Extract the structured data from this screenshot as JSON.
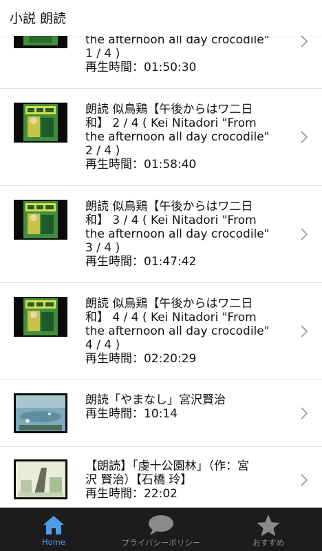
{
  "app": {
    "title": "小説 朗読"
  },
  "items": [
    {
      "title_lines": [
        "the afternoon all day crocodile\"",
        "1 / 4 )"
      ],
      "duration": "再生時間：01:50:30",
      "thumb": "kei-nitadori-book-cover"
    },
    {
      "title_lines": [
        "朗読 似鳥鶏【午後からはワ二日",
        "和】 2 / 4 ( Kei Nitadori \"From",
        "the afternoon all day crocodile\"",
        "2 / 4 )"
      ],
      "duration": "再生時間：01:58:40",
      "thumb": "kei-nitadori-book-cover"
    },
    {
      "title_lines": [
        "朗読 似鳥鶏【午後からはワ二日",
        "和】 3 / 4 ( Kei Nitadori \"From",
        "the afternoon all day crocodile\"",
        "3 / 4 )"
      ],
      "duration": "再生時間：01:47:42",
      "thumb": "kei-nitadori-book-cover"
    },
    {
      "title_lines": [
        "朗読 似鳥鶏【午後からはワ二日",
        "和】 4 / 4 ( Kei Nitadori \"From",
        "the afternoon all day crocodile\"",
        "4 / 4 )"
      ],
      "duration": "再生時間：02:20:29",
      "thumb": "kei-nitadori-book-cover"
    },
    {
      "title_lines": [
        "朗読「やまなし」宮沢賢治"
      ],
      "duration": "再生時間：10:14",
      "thumb": "yamanashi-underwater-illustration"
    },
    {
      "title_lines": [
        "【朗読】「虔十公園林」（作：宮",
        "沢 賢治）【石橋 玲】"
      ],
      "duration": "再生時間：22:02",
      "thumb": "kenju-park-forest-illustration"
    }
  ],
  "tabs": [
    {
      "label": "Home",
      "icon": "home-icon",
      "active": true
    },
    {
      "label": "プライバシーポリシー",
      "icon": "speech-bubble-icon",
      "active": false
    },
    {
      "label": "おすすめ",
      "icon": "star-icon",
      "active": false
    }
  ],
  "colors": {
    "accent": "#4f9de6",
    "tabbar_bg": "#1c1c1c",
    "divider": "#e2e2e2"
  }
}
